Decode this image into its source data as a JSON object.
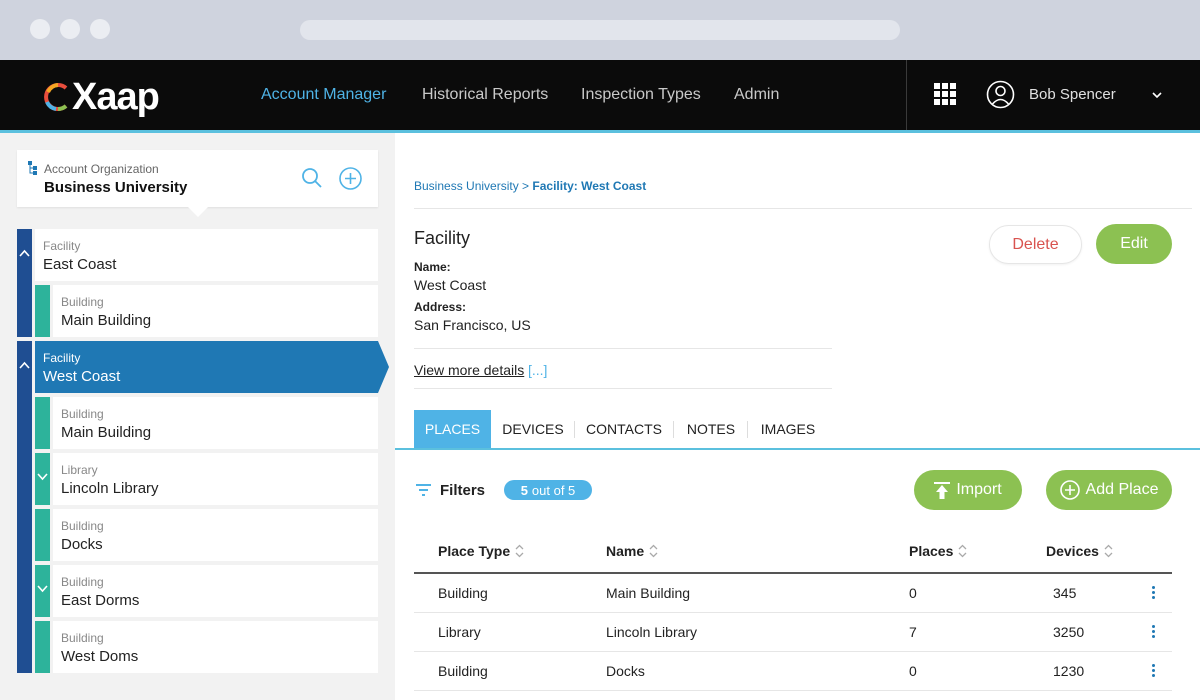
{
  "brand": {
    "logo_text": "Xaap"
  },
  "nav": {
    "items": [
      "Account Manager",
      "Historical Reports",
      "Inspection Types",
      "Admin"
    ],
    "active": "Account Manager"
  },
  "user": {
    "name": "Bob Spencer"
  },
  "org": {
    "label": "Account Organization",
    "name": "Business University"
  },
  "tree": {
    "facilities": [
      {
        "type": "Facility",
        "name": "East Coast",
        "selected": false,
        "children": [
          {
            "type": "Building",
            "name": "Main Building"
          }
        ]
      },
      {
        "type": "Facility",
        "name": "West Coast",
        "selected": true,
        "children": [
          {
            "type": "Building",
            "name": "Main Building",
            "expandable": false
          },
          {
            "type": "Library",
            "name": "Lincoln Library",
            "expandable": true
          },
          {
            "type": "Building",
            "name": "Docks",
            "expandable": false
          },
          {
            "type": "Building",
            "name": "East Dorms",
            "expandable": true
          },
          {
            "type": "Building",
            "name": "West Doms",
            "expandable": false
          }
        ]
      }
    ]
  },
  "breadcrumb": {
    "root": "Business University",
    "separator": ">",
    "current": "Facility: West Coast"
  },
  "facility": {
    "heading": "Facility",
    "name_label": "Name:",
    "name_value": "West Coast",
    "address_label": "Address:",
    "address_value": "San Francisco, US",
    "view_more": "View more details",
    "view_more_dots": "[...]"
  },
  "actions": {
    "delete": "Delete",
    "edit": "Edit"
  },
  "tabs": [
    "PLACES",
    "DEVICES",
    "CONTACTS",
    "NOTES",
    "IMAGES"
  ],
  "active_tab": "PLACES",
  "filters": {
    "label": "Filters",
    "count": "5",
    "count_suffix": "out of 5"
  },
  "buttons": {
    "import": "Import",
    "add_place": "Add Place"
  },
  "table": {
    "columns": [
      "Place Type",
      "Name",
      "Places",
      "Devices"
    ],
    "rows": [
      [
        "Building",
        "Main Building",
        "0",
        "345"
      ],
      [
        "Library",
        "Lincoln Library",
        "7",
        "3250"
      ],
      [
        "Building",
        "Docks",
        "0",
        "1230"
      ]
    ]
  },
  "colors": {
    "accent": "#4fb3e6",
    "facility_bar": "#1f4e92",
    "child_bar": "#2db39b",
    "selected": "#1f78b4",
    "action_green": "#8cc152",
    "danger": "#d9534f"
  }
}
